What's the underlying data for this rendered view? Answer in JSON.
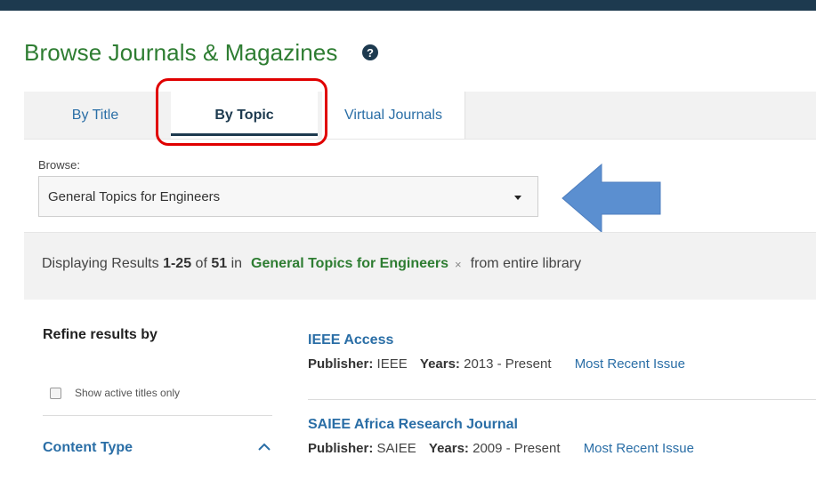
{
  "page": {
    "title": "Browse Journals & Magazines",
    "help_icon": "question-circle-icon"
  },
  "tabs": [
    {
      "label": "By Title",
      "active": false
    },
    {
      "label": "By Topic",
      "active": true
    },
    {
      "label": "Virtual Journals",
      "active": false
    }
  ],
  "browse": {
    "label": "Browse:",
    "selected": "General Topics for Engineers"
  },
  "results": {
    "prefix": "Displaying Results",
    "range": "1-25",
    "of_label": "of",
    "total": "51",
    "in_label": "in",
    "topic": "General Topics for Engineers",
    "remove_symbol": "×",
    "suffix": "from entire library"
  },
  "sidebar": {
    "title": "Refine results by",
    "active_titles_label": "Show active titles only",
    "content_type_label": "Content Type"
  },
  "items": [
    {
      "title": "IEEE Access",
      "publisher_label": "Publisher:",
      "publisher": "IEEE",
      "years_label": "Years:",
      "years": "2013 - Present",
      "link": "Most Recent Issue"
    },
    {
      "title": "SAIEE Africa Research Journal",
      "publisher_label": "Publisher:",
      "publisher": "SAIEE",
      "years_label": "Years:",
      "years": "2009 - Present",
      "link": "Most Recent Issue"
    }
  ],
  "colors": {
    "topbar": "#1d3a4f",
    "title_green": "#2e7d32",
    "link_blue": "#2a6ea6",
    "annotation_red": "#e00000",
    "annotation_arrow": "#5b8fd0"
  }
}
